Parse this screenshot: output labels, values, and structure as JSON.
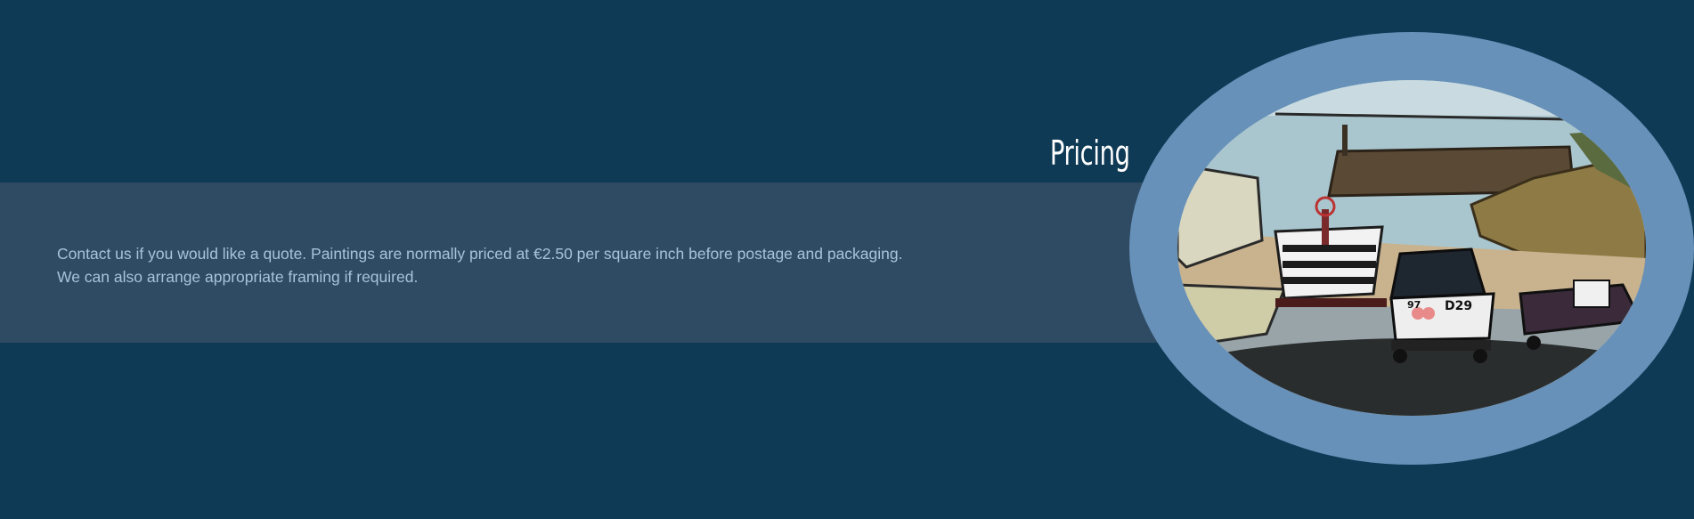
{
  "section": {
    "title": "Pricing",
    "paragraph_1": "Contact us if you would like a quote. Paintings are normally priced at €2.50 per square inch before postage and packaging.",
    "paragraph_2": "We can also arrange appropriate framing if required."
  },
  "painting": {
    "boat_registration_1": "D29",
    "boat_registration_2": "97"
  },
  "colors": {
    "page_background": "#0e3a55",
    "band_background": "#2f4a63",
    "body_text": "#a8c2db",
    "frame_ring": "#6791b9",
    "heading_text": "#ffffff"
  }
}
